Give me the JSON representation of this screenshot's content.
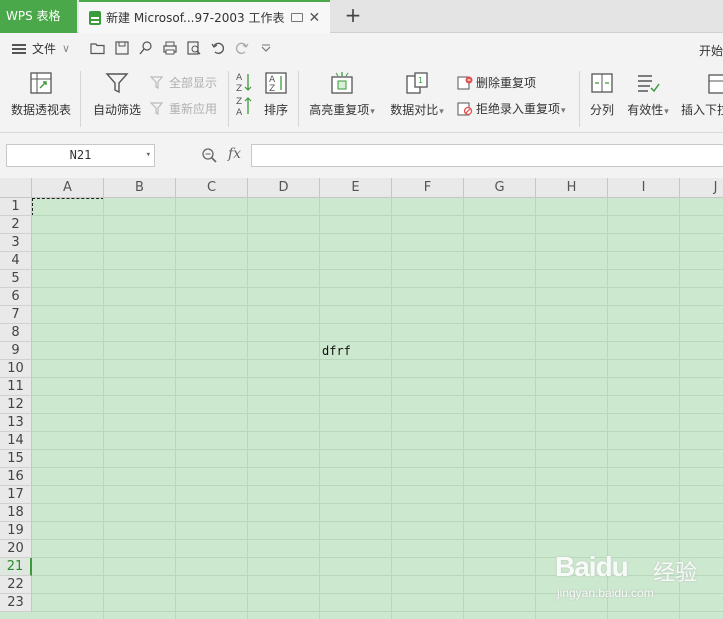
{
  "tabbar": {
    "app_tab": "WPS 表格",
    "doc_tab_title": "新建 Microsof...97-2003 工作表",
    "close_glyph": "✕",
    "new_tab_glyph": "+"
  },
  "menu": {
    "file_label": "文件",
    "file_caret": "∨",
    "start_tab": "开始"
  },
  "ribbon": {
    "pivot": "数据透视表",
    "auto_filter": "自动筛选",
    "show_all": "全部显示",
    "reapply": "重新应用",
    "sort": "排序",
    "highlight_dup": "高亮重复项",
    "compare": "数据对比",
    "delete_dup": "删除重复项",
    "reject_dup": "拒绝录入重复项",
    "split": "分列",
    "validity": "有效性",
    "insert_dropdown": "插入下拉"
  },
  "formula_bar": {
    "name_box": "N21",
    "fx_label": "fx",
    "formula": ""
  },
  "grid": {
    "columns": [
      "A",
      "B",
      "C",
      "D",
      "E",
      "F",
      "G",
      "H",
      "I",
      "J"
    ],
    "rows": [
      "1",
      "2",
      "3",
      "4",
      "5",
      "6",
      "7",
      "8",
      "9",
      "10",
      "11",
      "12",
      "13",
      "14",
      "15",
      "16",
      "17",
      "18",
      "19",
      "20",
      "21",
      "22",
      "23"
    ],
    "active_row": "21",
    "cell_e9": "dfrf"
  },
  "watermark": {
    "brand": "Baidu",
    "brand_cn": "经验",
    "url": "jingyan.baidu.com"
  },
  "colors": {
    "accent": "#4aa84a",
    "grid_bg": "#cce8cf"
  }
}
